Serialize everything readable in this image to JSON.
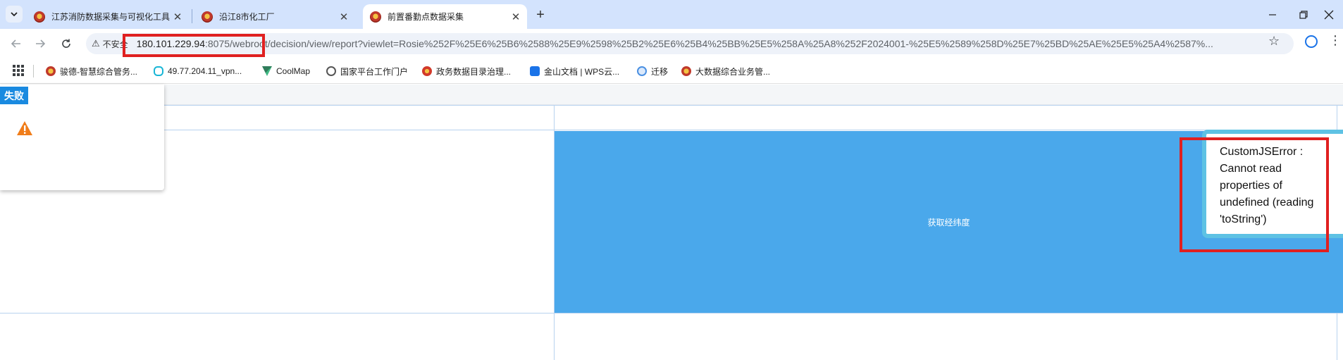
{
  "tabs": [
    {
      "title": "江苏消防数据采集与可视化工具",
      "active": false
    },
    {
      "title": "沿江8市化工厂",
      "active": false
    },
    {
      "title": "前置番勤点数据采集",
      "active": true
    }
  ],
  "toolbar": {
    "security_label": "不安全",
    "url_host": "180.101.229.94",
    "url_rest": ":8075/webroot/decision/view/report?viewlet=Rosie%252F%25E6%25B6%2588%25E9%2598%25B2%25E6%25B4%25BB%25E5%258A%25A8%252F2024001-%25E5%2589%258D%25E7%25BD%25AE%25E5%25A4%2587%..."
  },
  "bookmarks": [
    {
      "label": "骏德-智慧综合管务...",
      "icon": "emblem-icon"
    },
    {
      "label": "49.77.204.11_vpn...",
      "icon": "vpn-icon"
    },
    {
      "label": "CoolMap",
      "icon": "vue-icon"
    },
    {
      "label": "国家平台工作门户",
      "icon": "globe-icon"
    },
    {
      "label": "政务数据目录治理...",
      "icon": "gov-icon"
    },
    {
      "label": "金山文档 | WPS云...",
      "icon": "wps-icon"
    },
    {
      "label": "迁移",
      "icon": "migrate-icon"
    },
    {
      "label": "大数据综合业务管...",
      "icon": "emblem-icon"
    }
  ],
  "page": {
    "fail_title": "失败",
    "cell_button": "获取经纬度",
    "error_message": "CustomJSError : Cannot read properties of undefined (reading 'toString')"
  },
  "colors": {
    "accent_blue": "#4aa8eb",
    "highlight_red": "#e02020",
    "popup_border": "#5ec2e4",
    "fail_header": "#1a8ae0"
  }
}
